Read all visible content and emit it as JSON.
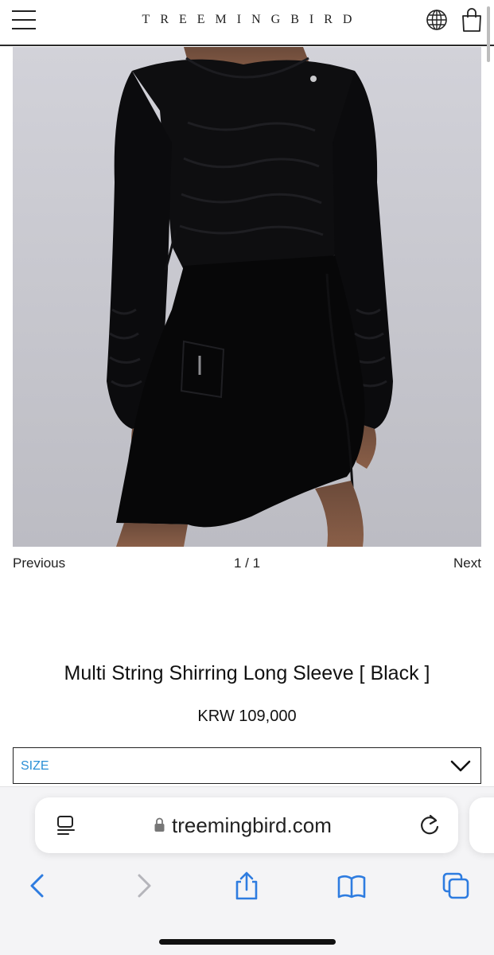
{
  "header": {
    "brand": "TREEMINGBIRD",
    "menu_icon": "hamburger-menu-icon",
    "language_icon": "globe-icon",
    "cart_icon": "shopping-bag-icon"
  },
  "gallery": {
    "prev_label": "Previous",
    "counter": "1 / 1",
    "next_label": "Next"
  },
  "product": {
    "title": "Multi String Shirring Long Sleeve [ Black ]",
    "price": "KRW 109,000",
    "size_select": {
      "label": "SIZE",
      "icon": "chevron-down-icon"
    }
  },
  "browser": {
    "url": "treemingbird.com",
    "reader_icon": "reader-view-icon",
    "lock_icon": "lock-icon",
    "reload_icon": "reload-icon",
    "toolbar": [
      "back-icon",
      "forward-icon",
      "share-icon",
      "bookmarks-icon",
      "tabs-icon"
    ]
  },
  "colors": {
    "accent": "#2b8fd6",
    "photo_background": "#c8c8cf",
    "garment": "#0d0d0f"
  }
}
